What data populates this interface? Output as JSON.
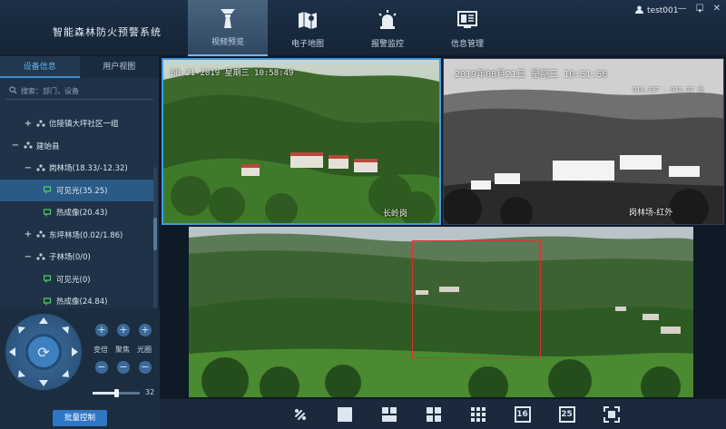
{
  "app": {
    "title": "智能森林防火预警系统"
  },
  "nav": [
    {
      "label": "视频预览",
      "icon": "tower-camera-icon",
      "active": true
    },
    {
      "label": "电子地图",
      "icon": "map-icon"
    },
    {
      "label": "报警监控",
      "icon": "alarm-light-icon"
    },
    {
      "label": "信息管理",
      "icon": "monitor-info-icon"
    }
  ],
  "user": {
    "name": "test001",
    "icon": "user-icon",
    "dropdown": "▾"
  },
  "window": {
    "minimize": "—",
    "maximize": "☐",
    "close": "✕"
  },
  "left_tabs": [
    {
      "label": "设备信息",
      "active": true
    },
    {
      "label": "用户视图"
    }
  ],
  "search": {
    "placeholder": "搜索：部门，设备"
  },
  "tree": [
    {
      "label": "信陵镇大坪社区一组",
      "expander": "+",
      "indent": 1,
      "icon": "group-icon"
    },
    {
      "label": "建始县",
      "expander": "−",
      "indent": 0,
      "icon": ""
    },
    {
      "label": "岗林场(18.33/-12.32)",
      "expander": "−",
      "indent": 1,
      "icon": "group-icon"
    },
    {
      "label": "可见光(35.25)",
      "expander": "",
      "indent": 2,
      "icon": "camera-icon",
      "selected": true
    },
    {
      "label": "热成像(20.43)",
      "expander": "",
      "indent": 2,
      "icon": "camera-icon"
    },
    {
      "label": "东坪林场(0.02/1.86)",
      "expander": "+",
      "indent": 1,
      "icon": "group-icon"
    },
    {
      "label": "子林场(0/0)",
      "expander": "−",
      "indent": 1,
      "icon": "group-icon"
    },
    {
      "label": "可见光(0)",
      "expander": "",
      "indent": 2,
      "icon": "camera-icon"
    },
    {
      "label": "热成像(24.84)",
      "expander": "",
      "indent": 2,
      "icon": "camera-icon"
    }
  ],
  "ptz": {
    "labels": {
      "zoom": "变倍",
      "focus": "聚焦",
      "iris": "光圈"
    },
    "plus": "+",
    "minus": "−",
    "speed": {
      "value": "32",
      "fraction": 0.5
    },
    "batch_label": "批量控制"
  },
  "cameras": {
    "cam1": {
      "timestamp": "08-21-2019  星期三  10:58:49",
      "label": "长岭岗"
    },
    "cam2": {
      "timestamp": "2019年08月21日  星期三  10:51:56",
      "coords": "018.337 - 012.32 北",
      "label": "岗林场-红外"
    }
  },
  "toolbar": [
    "ptz-link-icon",
    "layout-1-icon",
    "layout-3-icon",
    "layout-4-icon",
    "layout-9-icon",
    "layout-16-icon",
    "layout-25-icon",
    "fullscreen-icon"
  ],
  "toolbar_labels": {
    "l16": "16",
    "l25": "25"
  },
  "colors": {
    "accent": "#3d8fd4",
    "selected_row": "#2a5a86",
    "zoom_box": "#e03030"
  }
}
